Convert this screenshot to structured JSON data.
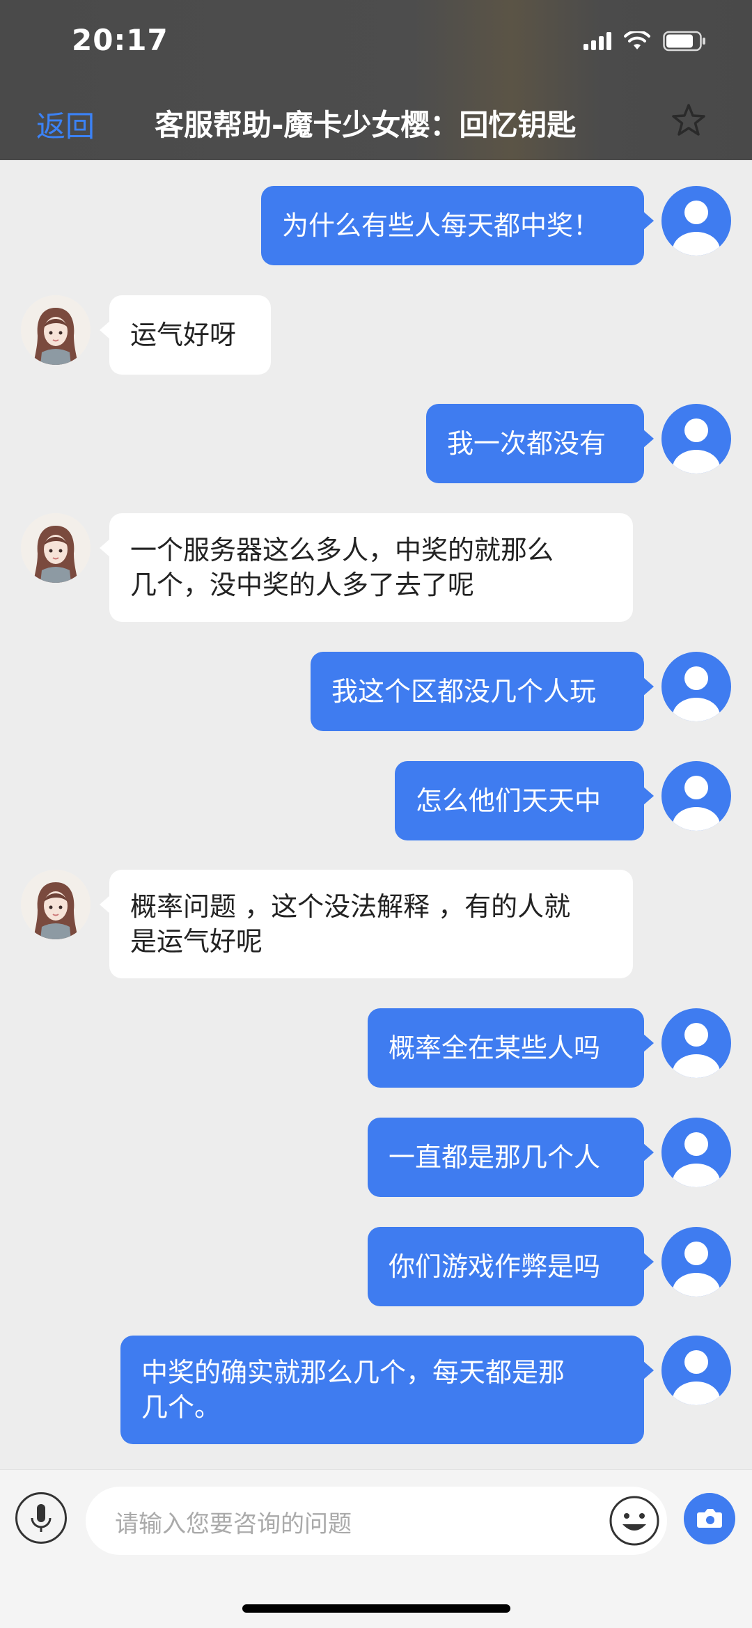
{
  "status_bar": {
    "time": "20:17"
  },
  "nav": {
    "back_label": "返回",
    "title": "客服帮助-魔卡少女樱：回忆钥匙"
  },
  "messages": [
    {
      "from": "user",
      "text": "为什么有些人每天都中奖！"
    },
    {
      "from": "bot",
      "text": "运气好呀"
    },
    {
      "from": "user",
      "text": "我一次都没有"
    },
    {
      "from": "bot",
      "line1": "一个服务器这么多人，中奖的就那么",
      "line2": "几个，没中奖的人多了去了呢"
    },
    {
      "from": "user",
      "text": "我这个区都没几个人玩"
    },
    {
      "from": "user",
      "text": "怎么他们天天中"
    },
    {
      "from": "bot",
      "line1": "概率问题 ，这个没法解释 ，有的人就",
      "line2": "是运气好呢"
    },
    {
      "from": "user",
      "text": "概率全在某些人吗"
    },
    {
      "from": "user",
      "text": "一直都是那几个人"
    },
    {
      "from": "user",
      "text": "你们游戏作弊是吗"
    },
    {
      "from": "user",
      "line1": "中奖的确实就那么几个，每天都是那",
      "line2": "几个。"
    }
  ],
  "input": {
    "placeholder": "请输入您要咨询的问题"
  },
  "colors": {
    "accent": "#3f7cf0",
    "header_bg": "#4a4a4a",
    "chat_bg": "#ededed"
  },
  "icons": [
    "signal-icon",
    "wifi-icon",
    "battery-icon",
    "star-icon",
    "user-avatar-icon",
    "bot-avatar",
    "microphone-icon",
    "emoji-icon",
    "camera-icon"
  ]
}
